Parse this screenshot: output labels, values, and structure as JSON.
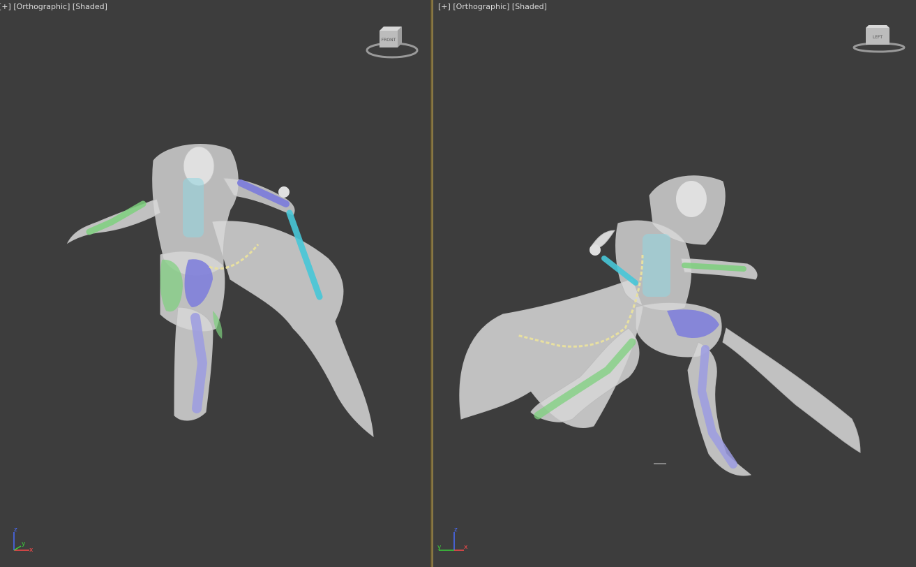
{
  "viewports": {
    "left": {
      "menu_plus": "[+]",
      "projection": "[Orthographic]",
      "shading": "[Shaded]",
      "viewcube_face": "FRONT",
      "axes": {
        "up": "z",
        "right": "y",
        "right2": "x"
      }
    },
    "right": {
      "menu_plus": "[+]",
      "projection": "[Orthographic]",
      "shading": "[Shaded]",
      "viewcube_face": "LEFT",
      "axes": {
        "up": "z",
        "left": "y",
        "right": "x"
      }
    }
  },
  "colors": {
    "background": "#3d3d3d",
    "splitter": "#7a6a3a",
    "mesh": "#d8d8d8",
    "bone_blue": "#7b7bdc",
    "bone_green": "#7ed07e",
    "bone_cyan": "#47c7d8",
    "chain_yellow": "#e8e0a0"
  }
}
